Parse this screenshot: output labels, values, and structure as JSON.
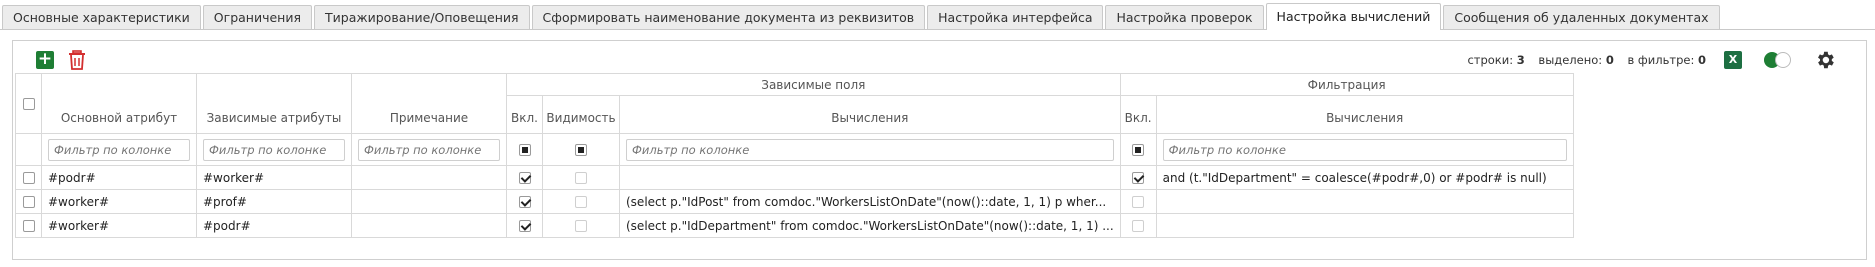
{
  "tabs": [
    {
      "label": "Основные характеристики",
      "active": false
    },
    {
      "label": "Ограничения",
      "active": false
    },
    {
      "label": "Тиражирование/Оповещения",
      "active": false
    },
    {
      "label": "Сформировать наименование документа из реквизитов",
      "active": false
    },
    {
      "label": "Настройка интерфейса",
      "active": false
    },
    {
      "label": "Настройка проверок",
      "active": false
    },
    {
      "label": "Настройка вычислений",
      "active": true
    },
    {
      "label": "Сообщения об удаленных документах",
      "active": false
    }
  ],
  "toolbar": {
    "add_icon": "plus-icon",
    "delete_icon": "trash-icon",
    "rows_label": "строки:",
    "rows_value": "3",
    "selected_label": "выделено:",
    "selected_value": "0",
    "filtered_label": "в фильтре:",
    "filtered_value": "0",
    "excel_label": "X",
    "settings_icon": "gear-icon"
  },
  "table": {
    "group_headers": {
      "dependent_fields": "Зависимые поля",
      "filtering": "Фильтрация"
    },
    "columns": {
      "main_attr": "Основной атрибут",
      "dep_attrs": "Зависимые атрибуты",
      "note": "Примечание",
      "enabled": "Вкл.",
      "visibility": "Видимость",
      "calc": "Вычисления",
      "filter_enabled": "Вкл.",
      "filter_calc": "Вычисления"
    },
    "filter_placeholder": "Фильтр по колонке",
    "rows": [
      {
        "main_attr": "#podr#",
        "dep_attrs": "#worker#",
        "note": "",
        "enabled": true,
        "visibility": false,
        "calc": "",
        "filter_enabled": true,
        "filter_calc": "and (t.\"IdDepartment\" = coalesce(#podr#,0) or #podr# is null)"
      },
      {
        "main_attr": "#worker#",
        "dep_attrs": "#prof#",
        "note": "",
        "enabled": true,
        "visibility": false,
        "calc": "(select p.\"IdPost\" from comdoc.\"WorkersListOnDate\"(now()::date, 1, 1) p wher...",
        "filter_enabled": false,
        "filter_calc": ""
      },
      {
        "main_attr": "#worker#",
        "dep_attrs": "#podr#",
        "note": "",
        "enabled": true,
        "visibility": false,
        "calc": "(select p.\"IdDepartment\" from comdoc.\"WorkersListOnDate\"(now()::date, 1, 1) ...",
        "filter_enabled": false,
        "filter_calc": ""
      }
    ]
  }
}
